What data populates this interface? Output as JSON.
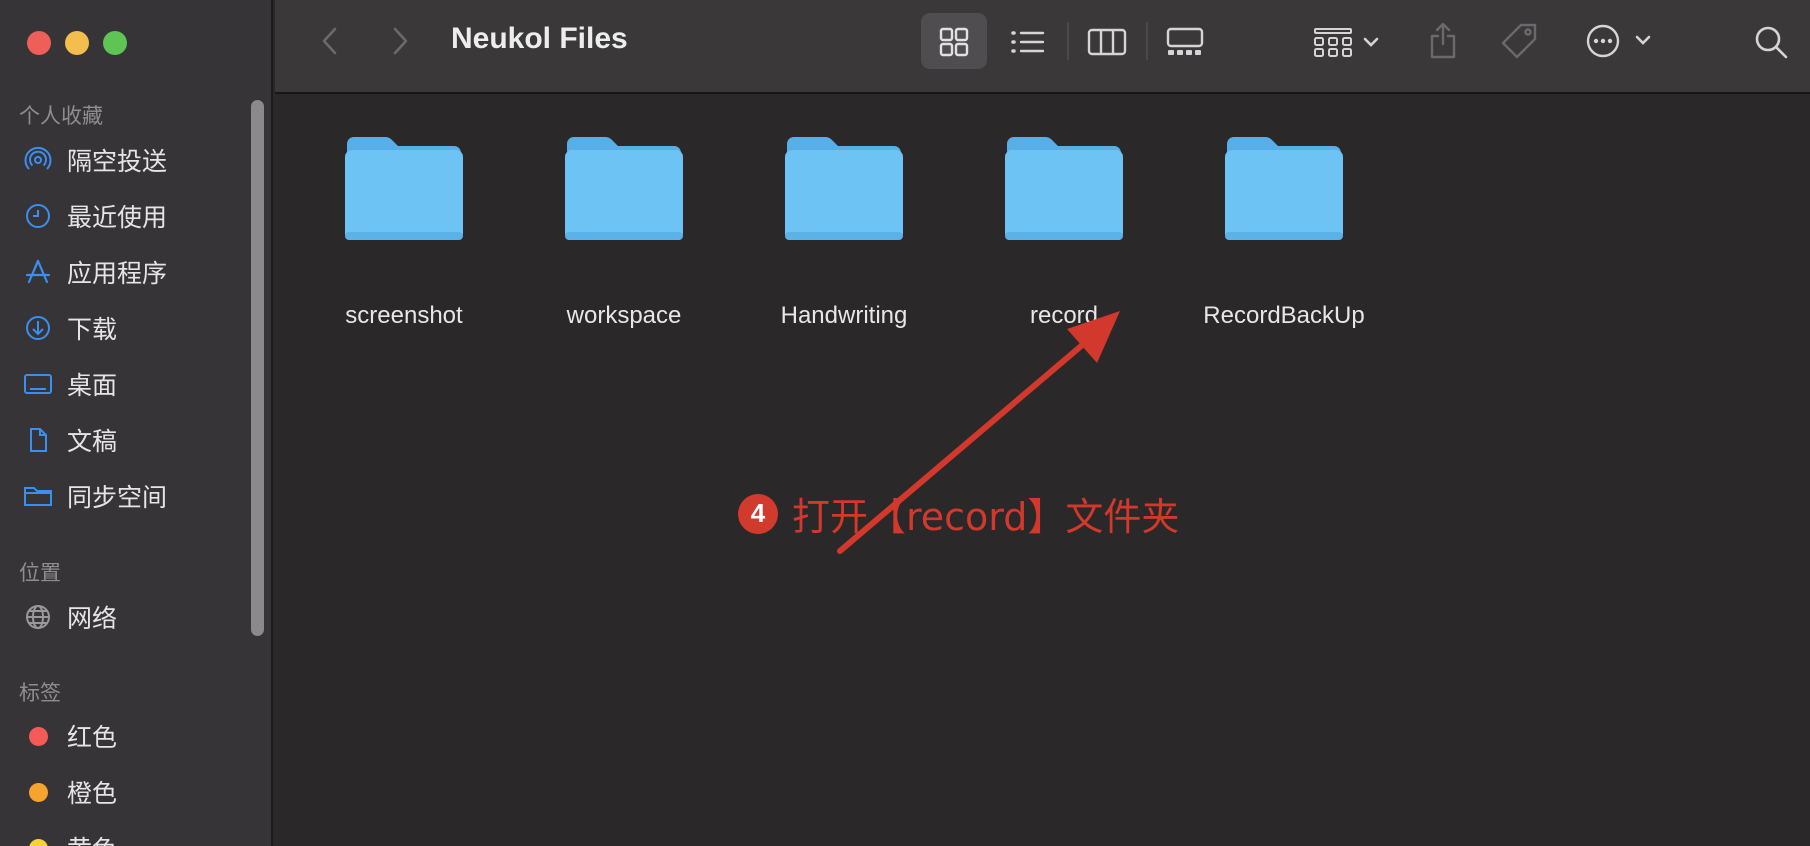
{
  "window": {
    "title": "Neukol Files"
  },
  "sidebar": {
    "sections": [
      {
        "title": "个人收藏",
        "items": [
          {
            "label": "隔空投送",
            "icon": "airdrop-icon"
          },
          {
            "label": "最近使用",
            "icon": "clock-icon"
          },
          {
            "label": "应用程序",
            "icon": "applications-icon"
          },
          {
            "label": "下载",
            "icon": "download-icon"
          },
          {
            "label": "桌面",
            "icon": "desktop-icon"
          },
          {
            "label": "文稿",
            "icon": "document-icon"
          },
          {
            "label": "同步空间",
            "icon": "folder-icon"
          }
        ]
      },
      {
        "title": "位置",
        "items": [
          {
            "label": "网络",
            "icon": "globe-icon"
          }
        ]
      },
      {
        "title": "标签",
        "items": [
          {
            "label": "红色",
            "color": "#f45b56"
          },
          {
            "label": "橙色",
            "color": "#f7a32f"
          },
          {
            "label": "黄色",
            "color": "#f5d43a"
          }
        ]
      }
    ]
  },
  "toolbar": {
    "buttons": [
      "back-icon",
      "forward-icon",
      "icon-view-icon",
      "list-view-icon",
      "column-view-icon",
      "gallery-view-icon",
      "group-icon",
      "share-icon",
      "tag-icon",
      "more-icon",
      "search-icon"
    ],
    "active_view": "icon"
  },
  "folders": [
    {
      "name": "screenshot"
    },
    {
      "name": "workspace"
    },
    {
      "name": "Handwriting"
    },
    {
      "name": "record"
    },
    {
      "name": "RecordBackUp"
    }
  ],
  "annotation": {
    "step": "4",
    "text": "打开【record】文件夹",
    "color": "#d3382c"
  },
  "colors": {
    "folder_body": "#6ec3f5",
    "folder_tab": "#58aee6",
    "accent_blue": "#3a8ff0"
  }
}
